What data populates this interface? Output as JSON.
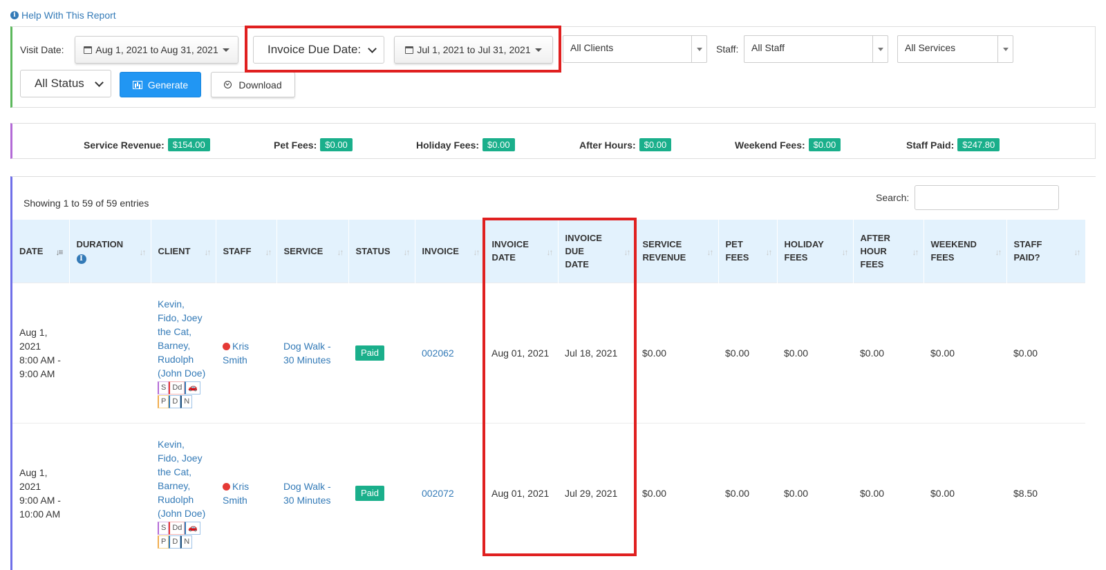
{
  "help": {
    "label": "Help With This Report"
  },
  "filters": {
    "visit_date_label": "Visit Date:",
    "visit_date_range": "Aug 1, 2021 to Aug 31, 2021",
    "date_type_select": "Invoice Due Date:",
    "invoice_date_range": "Jul 1, 2021 to Jul 31, 2021",
    "clients": "All Clients",
    "staff_label": "Staff:",
    "staff": "All Staff",
    "services": "All Services",
    "status": "All Status",
    "generate_label": "Generate",
    "download_label": "Download"
  },
  "summary": {
    "service_revenue": {
      "label": "Service Revenue:",
      "value": "$154.00"
    },
    "pet_fees": {
      "label": "Pet Fees:",
      "value": "$0.00"
    },
    "holiday_fees": {
      "label": "Holiday Fees:",
      "value": "$0.00"
    },
    "after_hours": {
      "label": "After Hours:",
      "value": "$0.00"
    },
    "weekend_fees": {
      "label": "Weekend Fees:",
      "value": "$0.00"
    },
    "staff_paid": {
      "label": "Staff Paid:",
      "value": "$247.80"
    }
  },
  "table": {
    "showing": "Showing 1 to 59 of 59 entries",
    "search_label": "Search:",
    "columns": {
      "date": "DATE",
      "duration": "DURATION",
      "client": "CLIENT",
      "staff": "STAFF",
      "service": "SERVICE",
      "status": "STATUS",
      "invoice": "INVOICE",
      "invoice_date_1": "INVOICE",
      "invoice_date_2": "DATE",
      "invoice_due_1": "INVOICE",
      "invoice_due_2": "DUE",
      "invoice_due_3": "DATE",
      "service_rev_1": "SERVICE",
      "service_rev_2": "REVENUE",
      "pet_fees_1": "PET",
      "pet_fees_2": "FEES",
      "holiday_1": "HOLIDAY",
      "holiday_2": "FEES",
      "after_1": "AFTER",
      "after_2": "HOUR",
      "after_3": "FEES",
      "weekend_1": "WEEKEND",
      "weekend_2": "FEES",
      "staff_paid_1": "STAFF",
      "staff_paid_2": "PAID?"
    },
    "tag_labels": {
      "s": "S",
      "dd": "Dd",
      "p": "P",
      "d": "D",
      "n": "N"
    },
    "rows": [
      {
        "date_1": "Aug 1,",
        "date_2": "2021",
        "date_3": "8:00 AM -",
        "date_4": "9:00 AM",
        "client_1": "Kevin,",
        "client_2": "Fido, Joey",
        "client_3": "the Cat,",
        "client_4": "Barney,",
        "client_5": "Rudolph",
        "client_6": "(John Doe)",
        "staff_1": "Kris",
        "staff_2": "Smith",
        "service_1": "Dog Walk -",
        "service_2": "30 Minutes",
        "status": "Paid",
        "invoice": "002062",
        "invoice_date": "Aug 01, 2021",
        "invoice_due": "Jul 18, 2021",
        "service_revenue": "$0.00",
        "pet_fees": "$0.00",
        "holiday_fees": "$0.00",
        "after_hours": "$0.00",
        "weekend_fees": "$0.00",
        "staff_paid": "$0.00"
      },
      {
        "date_1": "Aug 1,",
        "date_2": "2021",
        "date_3": "9:00 AM -",
        "date_4": "10:00 AM",
        "client_1": "Kevin,",
        "client_2": "Fido, Joey",
        "client_3": "the Cat,",
        "client_4": "Barney,",
        "client_5": "Rudolph",
        "client_6": "(John Doe)",
        "staff_1": "Kris",
        "staff_2": "Smith",
        "service_1": "Dog Walk -",
        "service_2": "30 Minutes",
        "status": "Paid",
        "invoice": "002072",
        "invoice_date": "Aug 01, 2021",
        "invoice_due": "Jul 29, 2021",
        "service_revenue": "$0.00",
        "pet_fees": "$0.00",
        "holiday_fees": "$0.00",
        "after_hours": "$0.00",
        "weekend_fees": "$0.00",
        "staff_paid": "$8.50"
      }
    ]
  },
  "colors": {
    "accent_blue": "#2196f3",
    "badge_green": "#1aaf8b",
    "link_blue": "#337ab7",
    "highlight_red": "#e02020",
    "header_bg": "#e3f2fd"
  }
}
